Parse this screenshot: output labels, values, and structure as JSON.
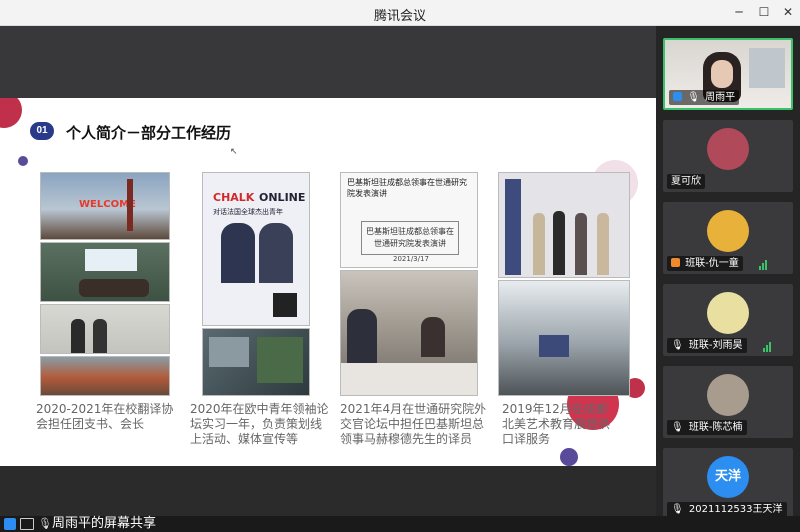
{
  "window": {
    "title": "腾讯会议"
  },
  "slide": {
    "badge": "01",
    "heading": "个人简介－部分工作经历",
    "captions": [
      "2020-2021年在校翻译协会担任团支书、会长",
      "2020年在欧中青年领袖论坛实习一年，负责策划线上活动、媒体宣传等",
      "2021年4月在世通研究院外交官论坛中担任巴基斯坦总领事马赫穆德先生的译员",
      "2019年12月在成都北美艺术教育展提供口译服务"
    ],
    "photo_texts": {
      "welcome": "WELCOME",
      "chalk": "CHALK",
      "online": "ONLINE",
      "forum_sub": "对话法国全球杰出青年",
      "doc_title": "巴基斯坦驻成都总领事在世通研究院发表演讲",
      "doc_box": "巴基斯坦驻成都总领事在世通研究院发表演讲",
      "doc_date": "2021/3/17"
    }
  },
  "participants": [
    {
      "name": "周雨平",
      "avatar_color": "#c9b8a8",
      "mic": "muted",
      "active": true
    },
    {
      "name": "夏可欣",
      "avatar_color": "#b04a5a"
    },
    {
      "name": "班联-仇一童",
      "avatar_color": "#e8b23a",
      "mic": "on"
    },
    {
      "name": "班联-刘雨昊",
      "avatar_color": "#e9dfa0",
      "mic": "on"
    },
    {
      "name": "班联-陈芯楠",
      "avatar_color": "#a89c8e",
      "mic": "muted"
    },
    {
      "name": "2021112533王天洋",
      "avatar_text": "天洋",
      "avatar_color": "#2b8ef0",
      "mic": "muted"
    }
  ],
  "bottom": {
    "share_label": "周雨平的屏幕共享"
  },
  "colors": {
    "accent": "#3cc16b",
    "slide_badge": "#2a3a8a",
    "deco_red": "#c0304a",
    "deco_purple": "#5a4a9a"
  }
}
